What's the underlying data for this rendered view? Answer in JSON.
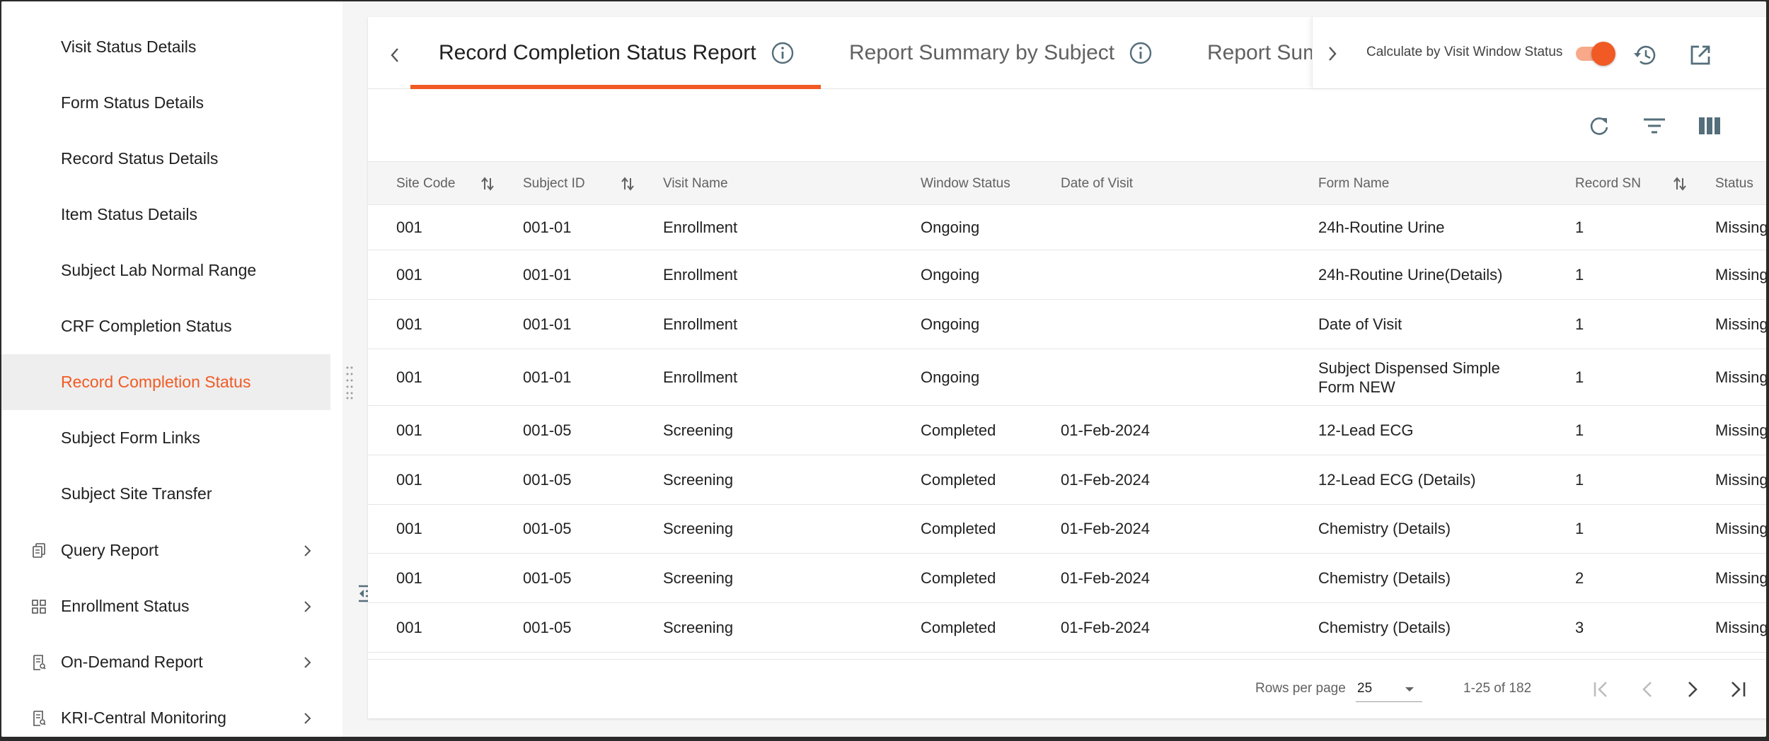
{
  "sidebar": {
    "items": [
      {
        "label": "Visit Status Details"
      },
      {
        "label": "Form Status Details"
      },
      {
        "label": "Record Status Details"
      },
      {
        "label": "Item Status Details"
      },
      {
        "label": "Subject Lab Normal Range"
      },
      {
        "label": "CRF Completion Status"
      },
      {
        "label": "Record Completion Status"
      },
      {
        "label": "Subject Form Links"
      },
      {
        "label": "Subject Site Transfer"
      }
    ],
    "active_item": "Record Completion Status",
    "groups": [
      {
        "label": "Query Report",
        "icon": "clipboard-copy-icon"
      },
      {
        "label": "Enrollment Status",
        "icon": "grid-icon"
      },
      {
        "label": "On-Demand Report",
        "icon": "report-icon"
      },
      {
        "label": "KRI-Central Monitoring",
        "icon": "report-icon"
      }
    ]
  },
  "tabs": {
    "items": [
      {
        "label": "Record Completion Status Report"
      },
      {
        "label": "Report Summary by Subject"
      },
      {
        "label": "Report Sum"
      }
    ],
    "active_index": 0
  },
  "options": {
    "calc_label": "Calculate by Visit Window Status",
    "calc_enabled": true
  },
  "table": {
    "columns": [
      {
        "label": "Site Code"
      },
      {
        "label": "Subject ID"
      },
      {
        "label": "Visit Name"
      },
      {
        "label": "Window Status"
      },
      {
        "label": "Date of Visit"
      },
      {
        "label": "Form Name"
      },
      {
        "label": "Record SN"
      },
      {
        "label": "Status"
      }
    ],
    "rows": [
      {
        "site": "001",
        "subject": "001-01",
        "visit": "Enrollment",
        "window": "Ongoing",
        "date": "",
        "form": "24h-Routine Urine",
        "sn": "1",
        "status": "Missing"
      },
      {
        "site": "001",
        "subject": "001-01",
        "visit": "Enrollment",
        "window": "Ongoing",
        "date": "",
        "form": "24h-Routine Urine(Details)",
        "sn": "1",
        "status": "Missing"
      },
      {
        "site": "001",
        "subject": "001-01",
        "visit": "Enrollment",
        "window": "Ongoing",
        "date": "",
        "form": "Date of Visit",
        "sn": "1",
        "status": "Missing"
      },
      {
        "site": "001",
        "subject": "001-01",
        "visit": "Enrollment",
        "window": "Ongoing",
        "date": "",
        "form": "Subject Dispensed Simple Form NEW",
        "sn": "1",
        "status": "Missing"
      },
      {
        "site": "001",
        "subject": "001-05",
        "visit": "Screening",
        "window": "Completed",
        "date": "01-Feb-2024",
        "form": "12-Lead ECG",
        "sn": "1",
        "status": "Missing"
      },
      {
        "site": "001",
        "subject": "001-05",
        "visit": "Screening",
        "window": "Completed",
        "date": "01-Feb-2024",
        "form": "12-Lead ECG (Details)",
        "sn": "1",
        "status": "Missing"
      },
      {
        "site": "001",
        "subject": "001-05",
        "visit": "Screening",
        "window": "Completed",
        "date": "01-Feb-2024",
        "form": "Chemistry (Details)",
        "sn": "1",
        "status": "Missing"
      },
      {
        "site": "001",
        "subject": "001-05",
        "visit": "Screening",
        "window": "Completed",
        "date": "01-Feb-2024",
        "form": "Chemistry (Details)",
        "sn": "2",
        "status": "Missing"
      },
      {
        "site": "001",
        "subject": "001-05",
        "visit": "Screening",
        "window": "Completed",
        "date": "01-Feb-2024",
        "form": "Chemistry (Details)",
        "sn": "3",
        "status": "Missing"
      }
    ]
  },
  "pagination": {
    "rows_per_page_label": "Rows per page",
    "rows_per_page": "25",
    "range": "1-25 of 182"
  },
  "colors": {
    "accent": "#f15a24",
    "text": "#212121",
    "muted": "#616161"
  }
}
